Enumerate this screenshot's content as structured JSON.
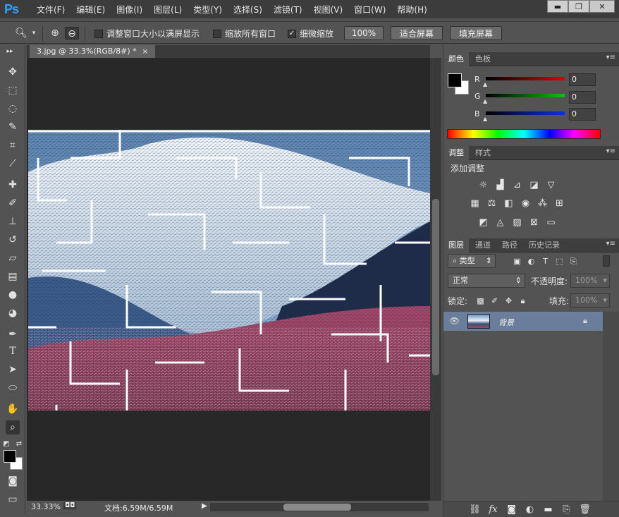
{
  "app": {
    "logo": "Ps"
  },
  "menu": [
    "文件(F)",
    "编辑(E)",
    "图像(I)",
    "图层(L)",
    "类型(Y)",
    "选择(S)",
    "滤镜(T)",
    "视图(V)",
    "窗口(W)",
    "帮助(H)"
  ],
  "window_controls": {
    "minimize": "▬",
    "maximize": "❐",
    "close": "✕"
  },
  "options": {
    "resize_windows_label": "调整窗口大小以满屏显示",
    "resize_windows_checked": false,
    "zoom_all_label": "缩放所有窗口",
    "zoom_all_checked": false,
    "scrubby_label": "细微缩放",
    "scrubby_checked": true,
    "check_mark": "✓",
    "btn_100": "100%",
    "btn_fit": "适合屏幕",
    "btn_fill": "填充屏幕"
  },
  "document": {
    "tab_title": "3.jpg @ 33.3%(RGB/8#) *",
    "tab_close": "×",
    "zoom": "33.33%",
    "doc_info": "文档:6.59M/6.59M"
  },
  "panels": {
    "color": {
      "tabs": [
        "颜色",
        "色板"
      ],
      "r_label": "R",
      "g_label": "G",
      "b_label": "B",
      "r_value": "0",
      "g_value": "0",
      "b_value": "0",
      "r_color": "#e00000",
      "g_color": "#10c010",
      "b_color": "#1030e8"
    },
    "adjustments": {
      "tabs": [
        "调整",
        "样式"
      ],
      "add_label": "添加调整"
    },
    "layers": {
      "tabs": [
        "图层",
        "通道",
        "路径",
        "历史记录"
      ],
      "filter_kind": "类型",
      "blend_mode": "正常",
      "opacity_label": "不透明度:",
      "opacity_value": "100%",
      "lock_label": "锁定:",
      "fill_label": "填充:",
      "fill_value": "100%",
      "layer_name": "背景"
    },
    "menu_icon": "▾≡"
  },
  "colors": {
    "accent_ps_logo": "#2fa3ff",
    "fg_color": "#000000",
    "bg_color": "#ffffff",
    "layer_selected": "#6a7e9b"
  }
}
